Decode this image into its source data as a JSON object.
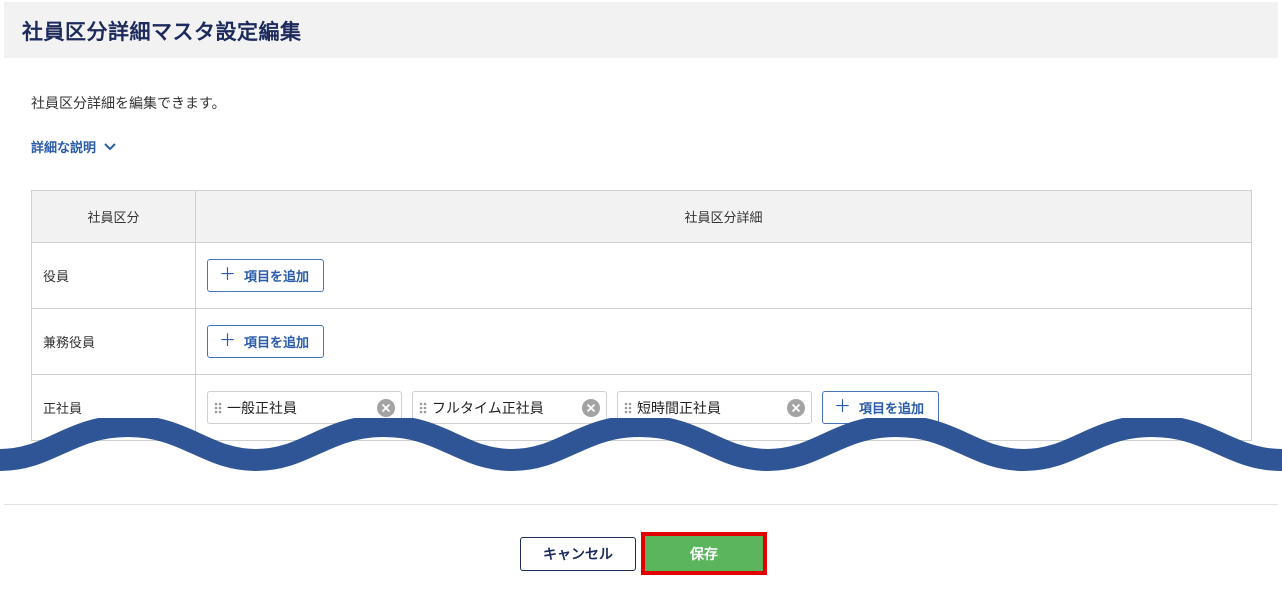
{
  "header": {
    "title": "社員区分詳細マスタ設定編集"
  },
  "description": "社員区分詳細を編集できます。",
  "details_toggle": {
    "label": "詳細な説明",
    "icon": "chevron-down-icon"
  },
  "table": {
    "headers": [
      "社員区分",
      "社員区分詳細"
    ],
    "add_item_label": "項目を追加",
    "rows": [
      {
        "type": "役員",
        "items": []
      },
      {
        "type": "兼務役員",
        "items": []
      },
      {
        "type": "正社員",
        "items": [
          "一般正社員",
          "フルタイム正社員",
          "短時間正社員"
        ]
      }
    ]
  },
  "actions": {
    "cancel": "キャンセル",
    "save": "保存"
  },
  "colors": {
    "title": "#1d2a5c",
    "link": "#2a5caa",
    "save": "#5bb55d",
    "highlight": "#e00000",
    "wave": "#2f5597"
  }
}
